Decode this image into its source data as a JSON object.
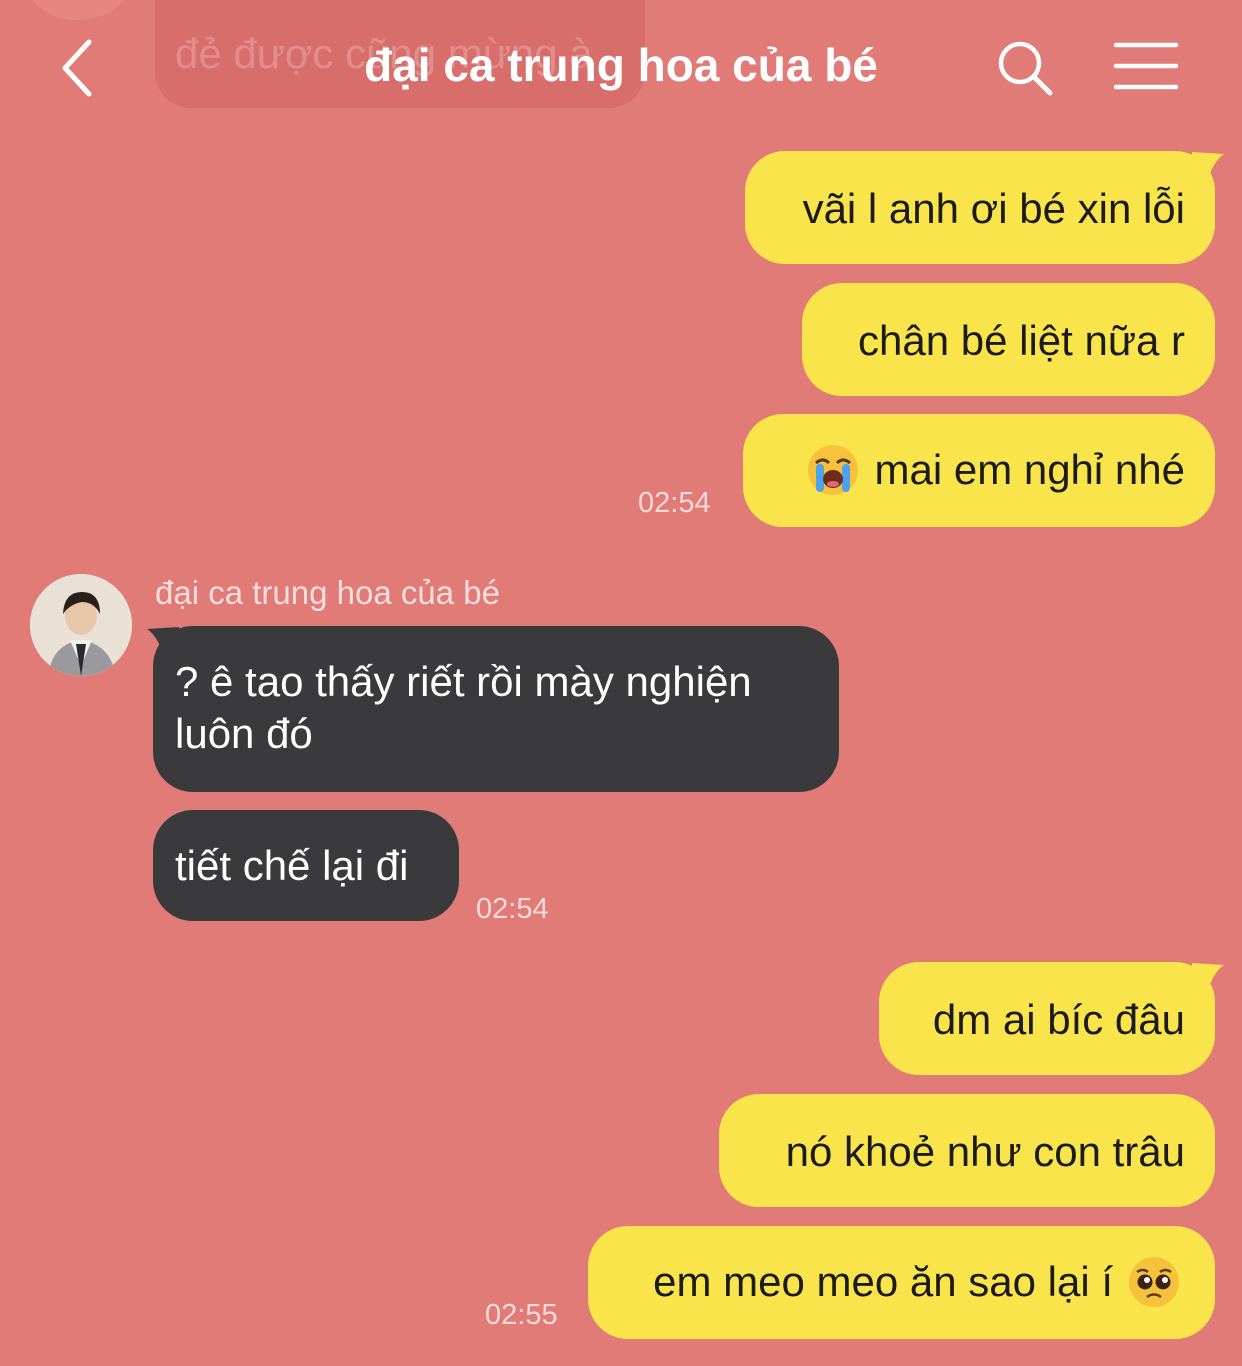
{
  "header": {
    "title": "đại ca trung hoa của bé",
    "back_icon": "chevron-left-icon",
    "search_icon": "search-icon",
    "menu_icon": "hamburger-menu-icon"
  },
  "previous_message": {
    "text": "đẻ được cũng mừng à"
  },
  "messages": [
    {
      "direction": "out",
      "text": "vãi l anh ơi bé xin lỗi"
    },
    {
      "direction": "out",
      "text": "chân bé liệt nữa r"
    },
    {
      "direction": "out",
      "emoji": "loudly-crying-face",
      "text": "mai em nghỉ nhé",
      "time": "02:54"
    },
    {
      "direction": "in",
      "sender": "đại ca trung hoa của bé",
      "line1": "? ê tao thấy riết rồi mày nghiện",
      "line2": "luôn đó"
    },
    {
      "direction": "in",
      "text": "tiết chế lại đi",
      "time": "02:54"
    },
    {
      "direction": "out",
      "text": "dm ai bíc đâu"
    },
    {
      "direction": "out",
      "text": "nó khoẻ như con trâu"
    },
    {
      "direction": "out",
      "text": "em meo meo ăn sao lại í",
      "emoji": "pleading-face",
      "time": "02:55"
    }
  ],
  "colors": {
    "background": "#e07b78",
    "outgoing_bubble": "#fae44b",
    "incoming_bubble": "#3a3a3c"
  }
}
